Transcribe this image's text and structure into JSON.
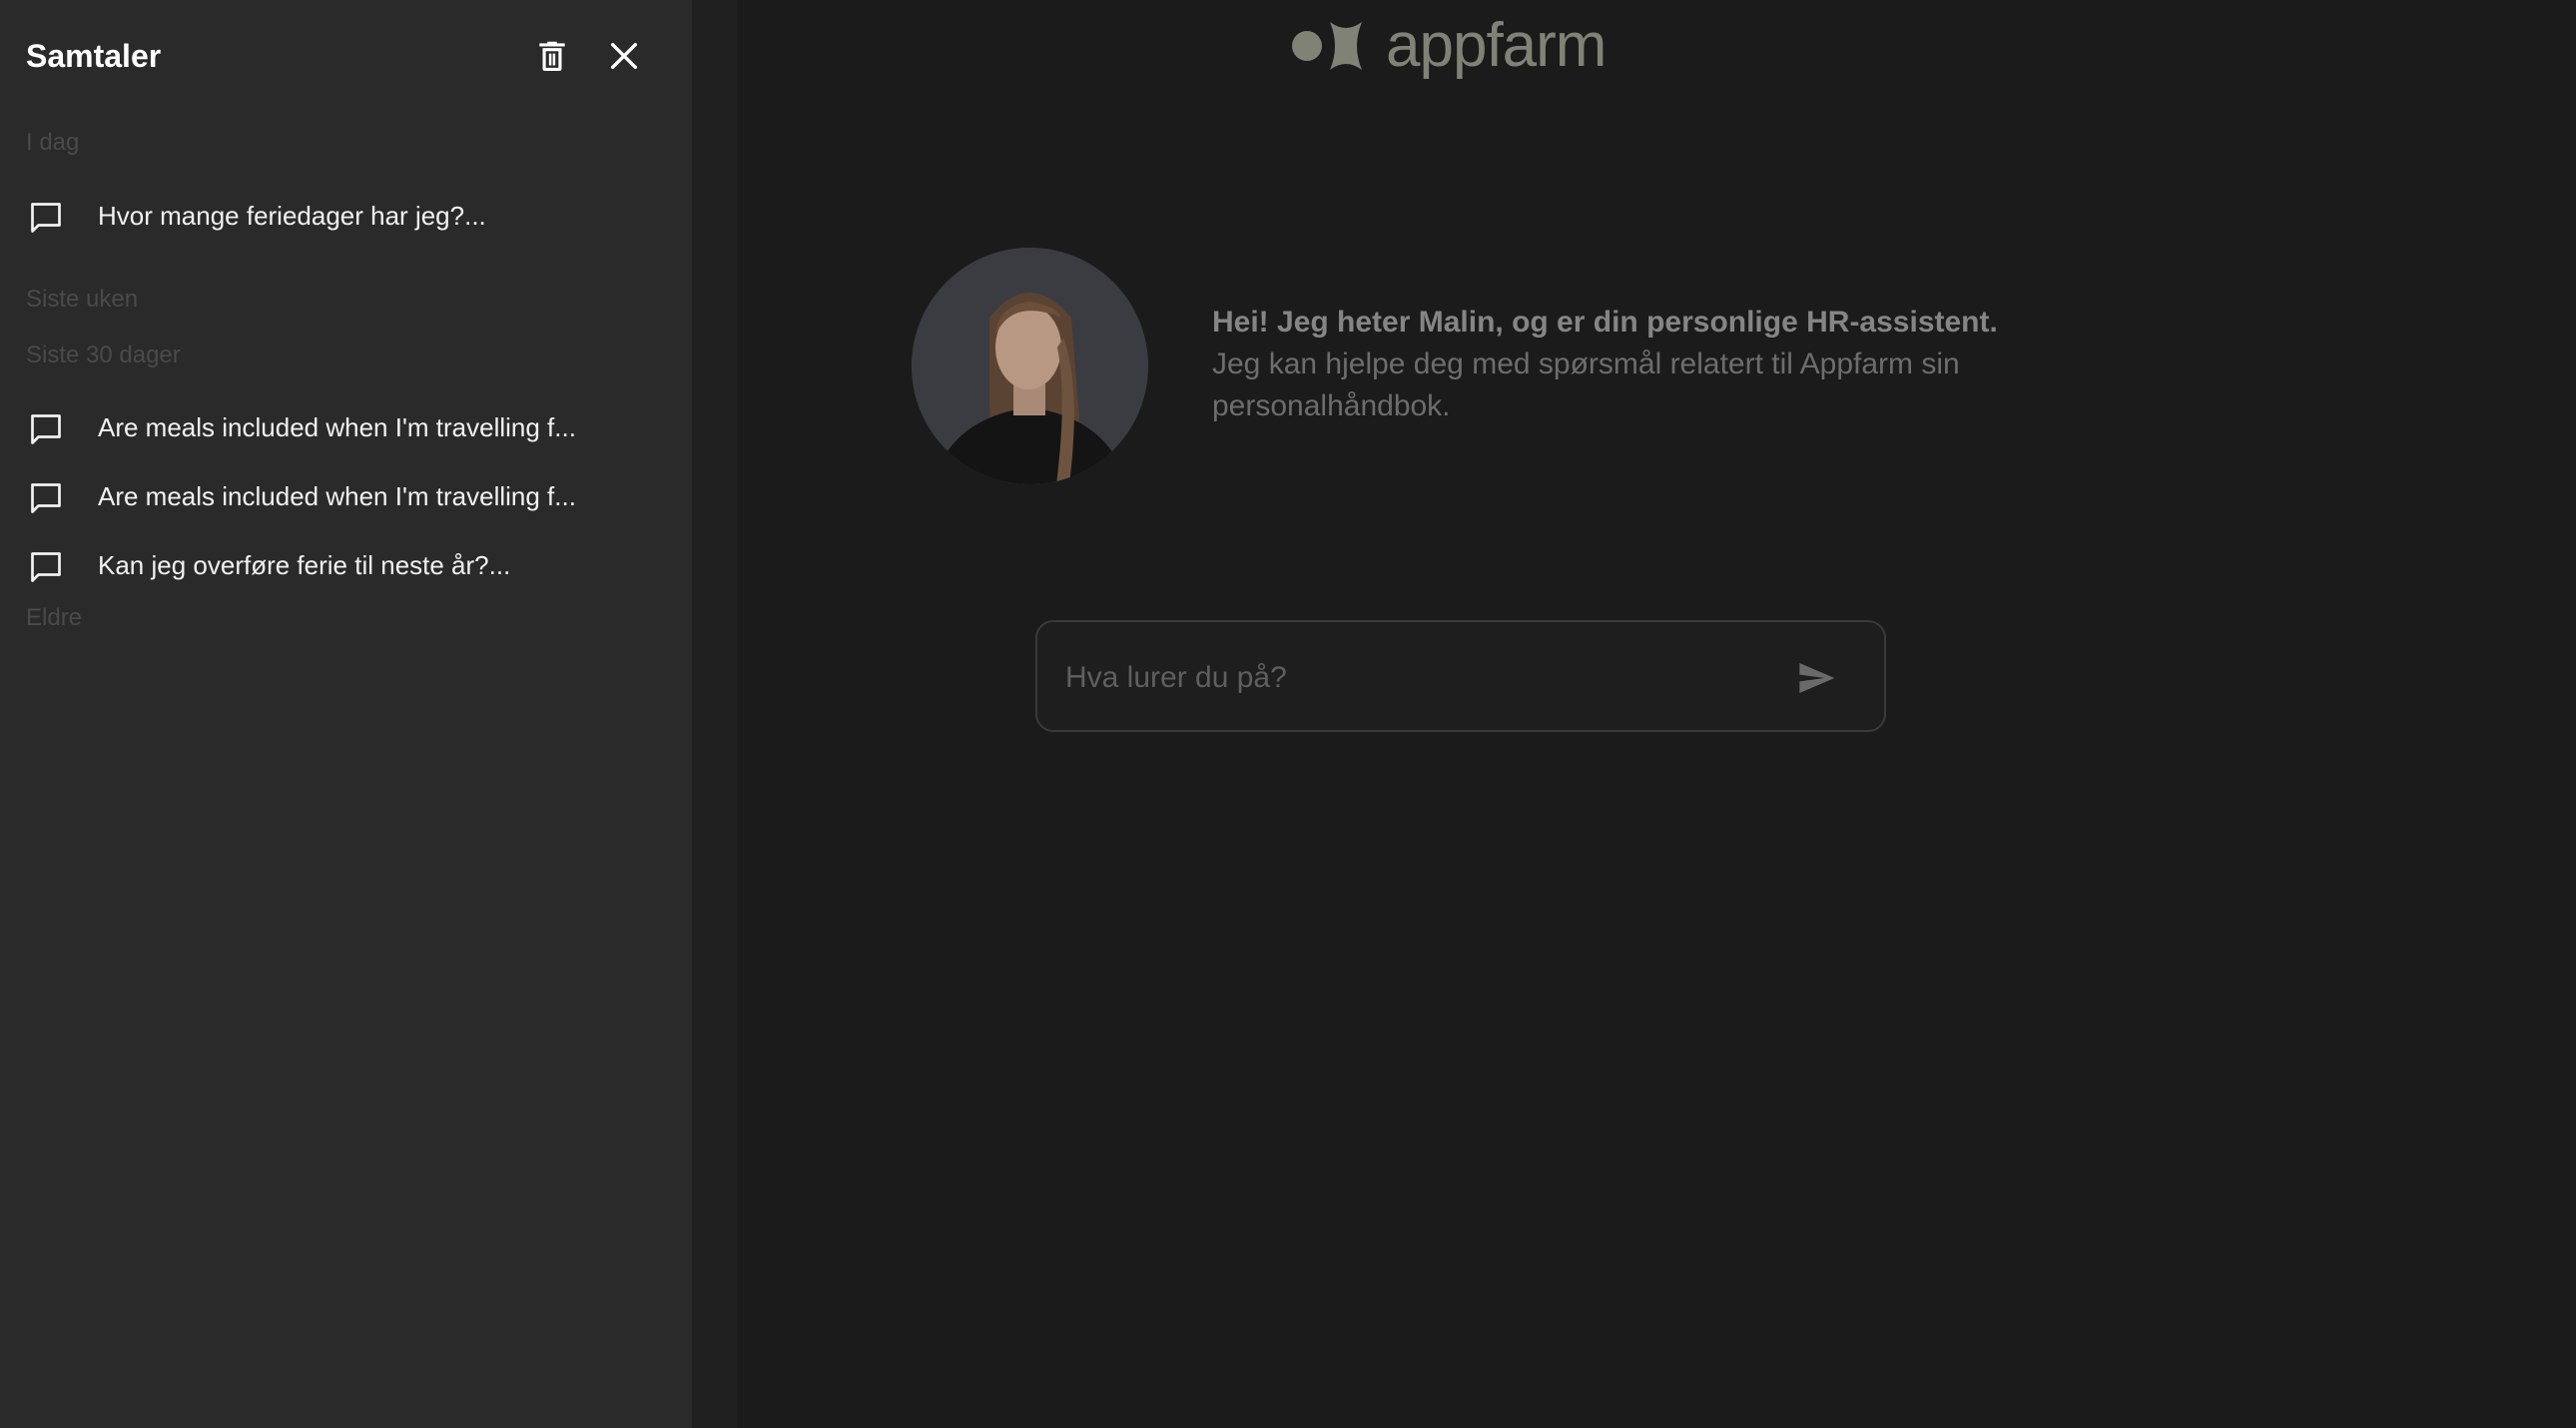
{
  "drawer": {
    "title": "Samtaler",
    "delete_icon": "trash-icon",
    "close_icon": "close-icon",
    "sections": {
      "today": "I dag",
      "last_week": "Siste uken",
      "last_30_days": "Siste 30 dager",
      "older": "Eldre"
    },
    "conversations": [
      {
        "label": "Hvor mange feriedager har jeg?...",
        "icon": "chat-bubble-icon"
      },
      {
        "label": "Are meals included when I'm travelling f...",
        "icon": "chat-bubble-icon"
      },
      {
        "label": "Are meals included when I'm travelling f...",
        "icon": "chat-bubble-icon"
      },
      {
        "label": "Kan jeg overføre ferie til neste år?...",
        "icon": "chat-bubble-icon"
      }
    ]
  },
  "main": {
    "logo_text": "appfarm",
    "intro_title": "Hei! Jeg heter Malin, og er din personlige HR-assistent.",
    "intro_body_line1": "Jeg kan hjelpe deg med spørsmål relatert til Appfarm sin",
    "intro_body_line2": "personalhåndbok.",
    "input": {
      "value": "",
      "placeholder": "Hva lurer du på?"
    },
    "send_icon": "send-icon"
  },
  "colors": {
    "drawer_bg": "#2a2a2a",
    "main_bg": "#1b1b1b",
    "logo": "#7f8275",
    "section_label": "#4a4a4a"
  }
}
